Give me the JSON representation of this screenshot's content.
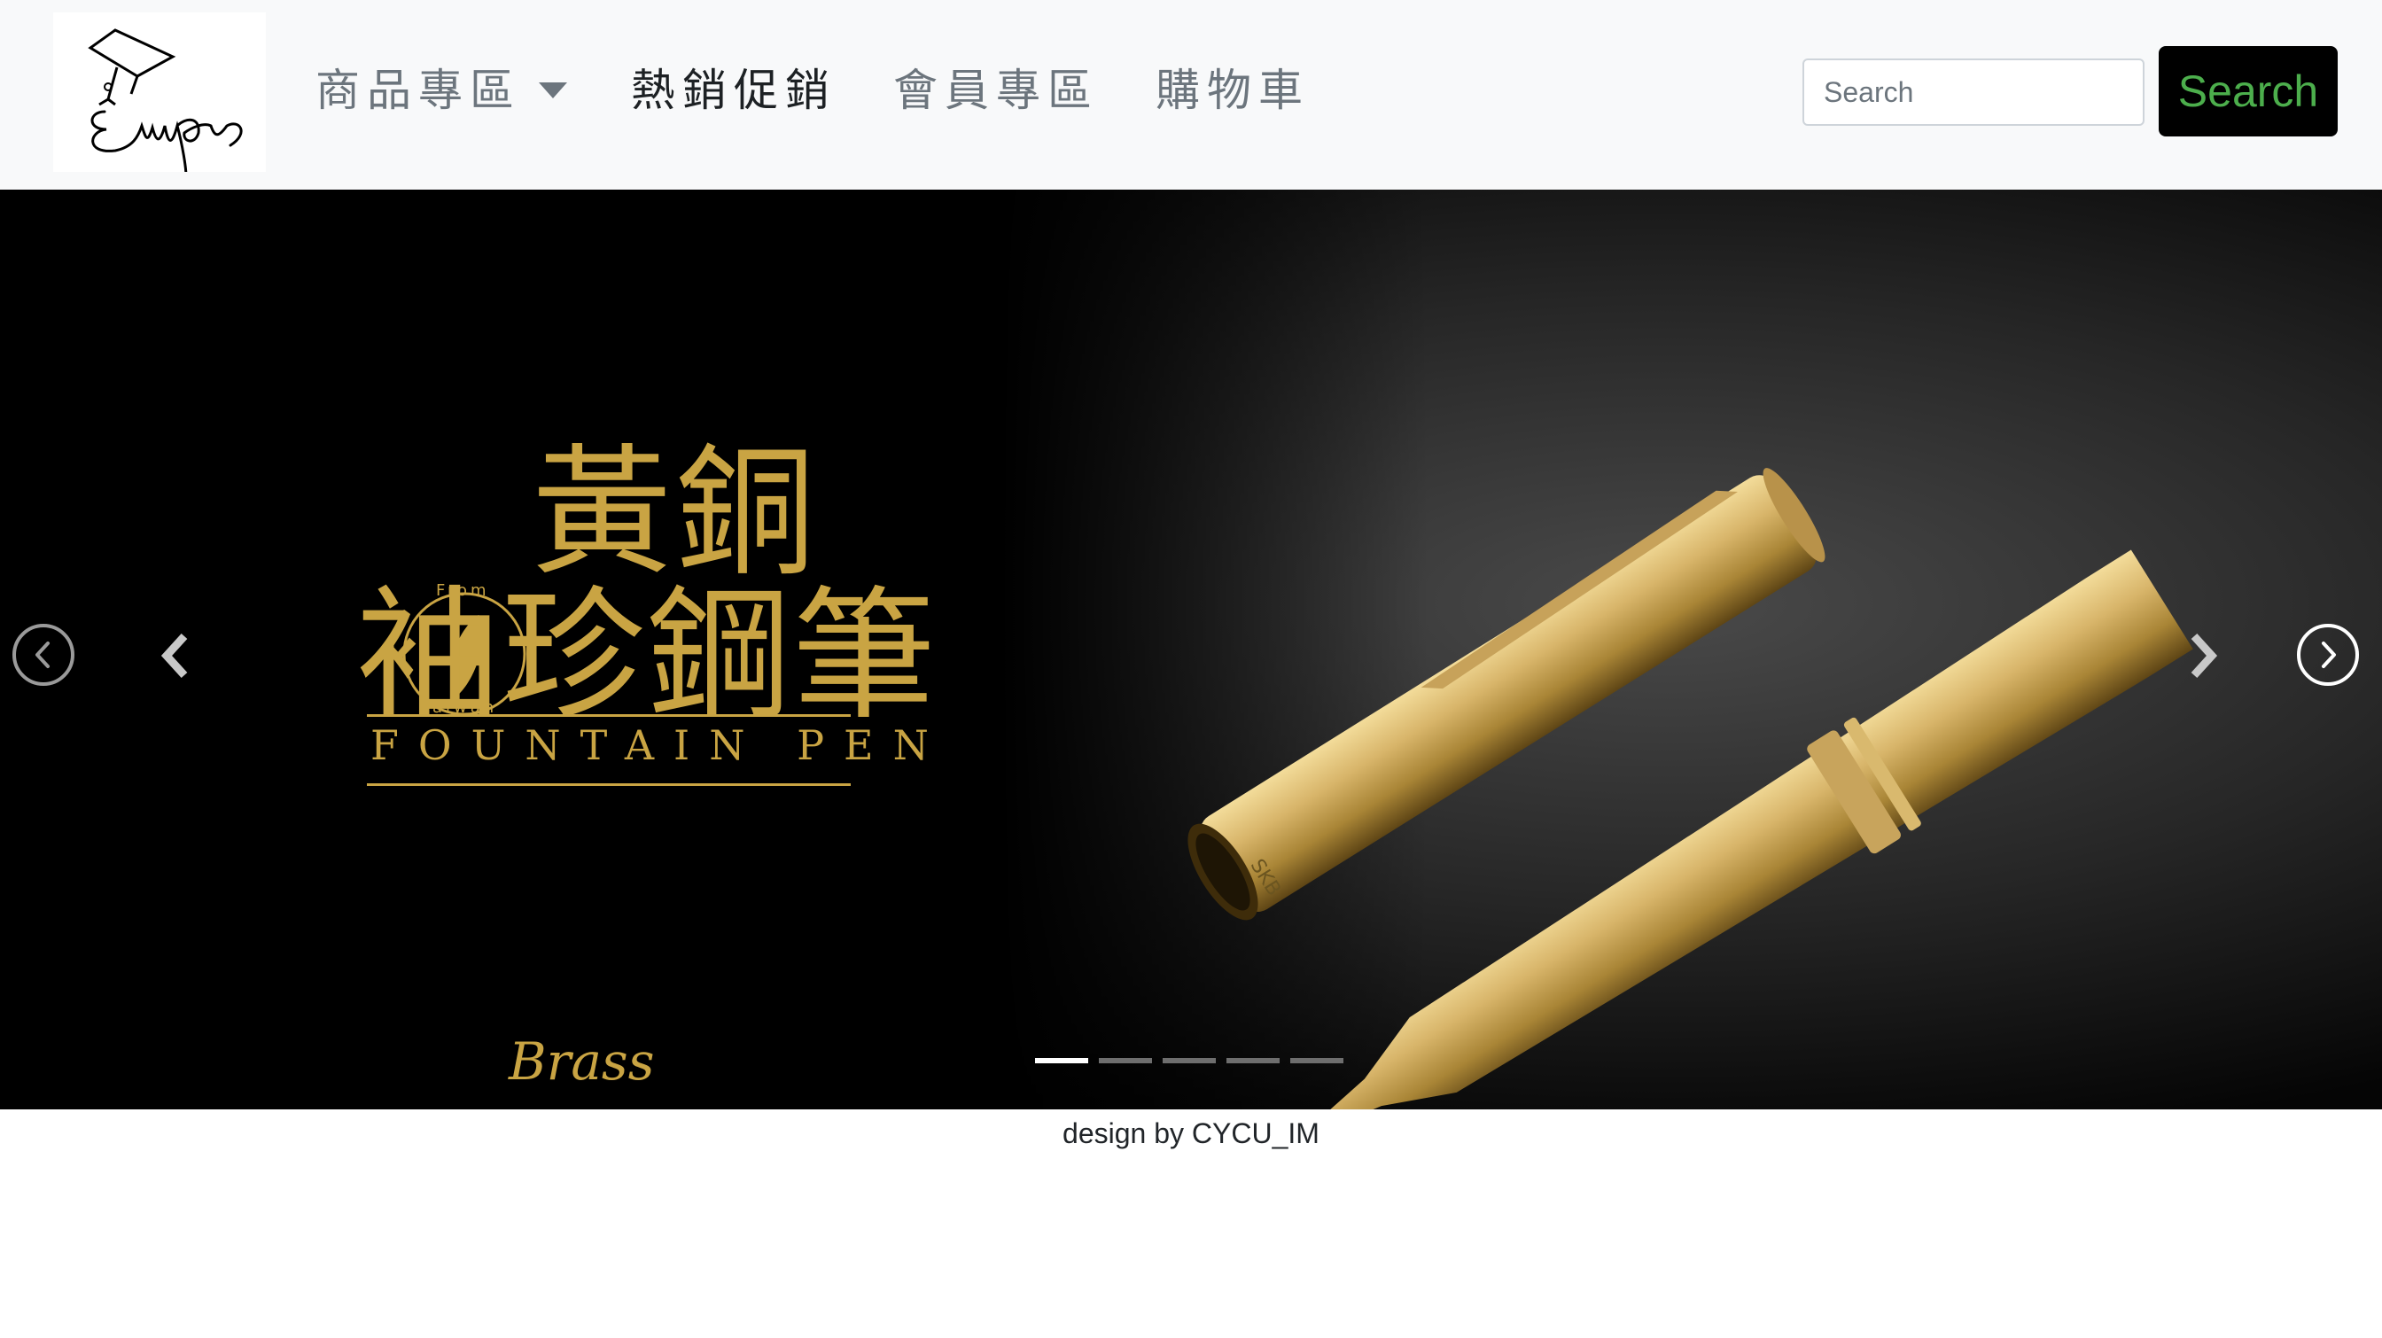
{
  "navbar": {
    "items": [
      {
        "label": "商品專區",
        "active": false,
        "has_dropdown": true
      },
      {
        "label": "熱銷促銷",
        "active": true,
        "has_dropdown": false
      },
      {
        "label": "會員專區",
        "active": false,
        "has_dropdown": false
      },
      {
        "label": "購物車",
        "active": false,
        "has_dropdown": false
      }
    ],
    "search": {
      "placeholder": "Search",
      "button_label": "Search"
    },
    "logo_text": "imps"
  },
  "carousel": {
    "slide": {
      "title_line1": "黃銅",
      "title_line2": "袖珍鋼筆",
      "subtitle": "FOUNTAIN PEN",
      "signature": "Brass",
      "seal_top": "From",
      "seal_bottom": "Taiwan",
      "pen_mark": "SKB"
    },
    "slide_count": 5,
    "active_index": 0
  },
  "footer": {
    "text": "design by CYCU_IM"
  },
  "colors": {
    "navbar_bg": "#f8f9fa",
    "nav_text": "#6c757d",
    "nav_active": "#1d2124",
    "search_button_bg": "#000000",
    "search_button_text": "#4cae4c",
    "gold": "#c9a443"
  }
}
